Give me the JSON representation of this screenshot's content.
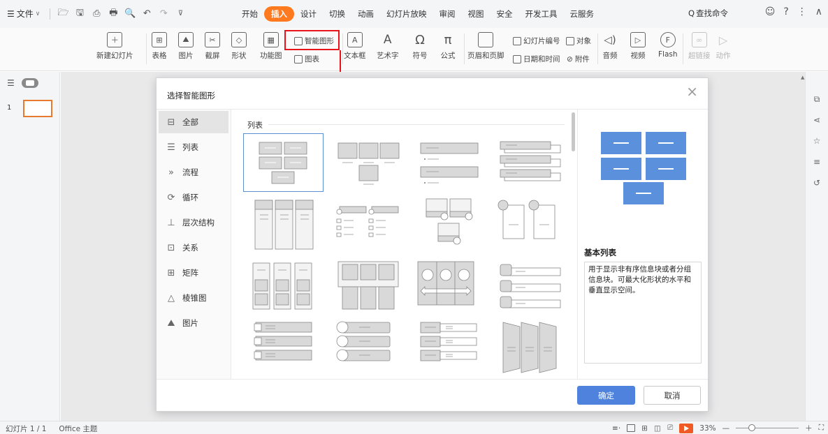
{
  "menubar": {
    "file_label": "文件",
    "tabs": [
      {
        "label": "开始",
        "active": false
      },
      {
        "label": "插入",
        "active": true
      },
      {
        "label": "设计",
        "active": false
      },
      {
        "label": "切换",
        "active": false
      },
      {
        "label": "动画",
        "active": false
      },
      {
        "label": "幻灯片放映",
        "active": false
      },
      {
        "label": "审阅",
        "active": false
      },
      {
        "label": "视图",
        "active": false
      },
      {
        "label": "安全",
        "active": false
      },
      {
        "label": "开发工具",
        "active": false
      },
      {
        "label": "云服务",
        "active": false
      }
    ],
    "search_label": "查找命令",
    "accent_color": "#ff7a1e"
  },
  "ribbon": {
    "new_slide": "新建幻灯片",
    "table": "表格",
    "picture": "图片",
    "screenshot": "截屏",
    "shape": "形状",
    "function_chart": "功能图",
    "smart_art": "智能图形",
    "chart": "图表",
    "textbox": "文本框",
    "art_text": "艺术字",
    "symbol": "符号",
    "formula": "公式",
    "header_footer": "页眉和页脚",
    "slide_number": "幻灯片编号",
    "object": "对象",
    "date_time": "日期和时间",
    "attachment": "附件",
    "audio": "音频",
    "video": "视频",
    "flash": "Flash",
    "hyperlink": "超链接",
    "action": "动作"
  },
  "slides": {
    "thumb_number": "1"
  },
  "dialog": {
    "title": "选择智能图形",
    "categories": [
      {
        "label": "全部",
        "icon": "smartart-icon",
        "active": true
      },
      {
        "label": "列表",
        "icon": "list-icon",
        "active": false
      },
      {
        "label": "流程",
        "icon": "process-icon",
        "active": false
      },
      {
        "label": "循环",
        "icon": "cycle-icon",
        "active": false
      },
      {
        "label": "层次结构",
        "icon": "hierarchy-icon",
        "active": false
      },
      {
        "label": "关系",
        "icon": "relationship-icon",
        "active": false
      },
      {
        "label": "矩阵",
        "icon": "matrix-icon",
        "active": false
      },
      {
        "label": "棱锥图",
        "icon": "pyramid-icon",
        "active": false
      },
      {
        "label": "图片",
        "icon": "picture-icon",
        "active": false
      }
    ],
    "section_heading": "列表",
    "preview": {
      "name": "基本列表",
      "description": "用于显示非有序信息块或者分组信息块。可最大化形状的水平和垂直显示空间。",
      "block_color": "#5a90dc"
    },
    "ok_label": "确定",
    "cancel_label": "取消"
  },
  "statusbar": {
    "slide_info": "幻灯片 1 / 1",
    "theme": "Office 主题",
    "zoom": "33%"
  }
}
